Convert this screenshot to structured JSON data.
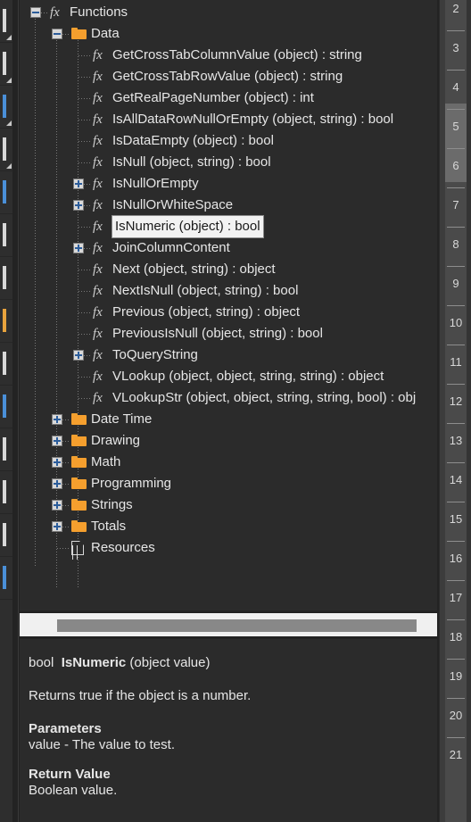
{
  "left_strip": {
    "name": "adjacent-panel-sliver",
    "items": [
      {
        "mark": "white"
      },
      {
        "mark": "white"
      },
      {
        "mark": "blue"
      },
      {
        "mark": "white"
      },
      {
        "mark": "blue"
      },
      {
        "mark": "white"
      },
      {
        "mark": "white"
      },
      {
        "mark": "orange"
      },
      {
        "mark": "white"
      },
      {
        "mark": "blue"
      },
      {
        "mark": "white"
      },
      {
        "mark": "white"
      },
      {
        "mark": "white"
      },
      {
        "mark": "blue"
      }
    ]
  },
  "tree": {
    "name": "functions-tree",
    "nodes": [
      {
        "label": "Functions",
        "depth": 0,
        "icon": "fx-icon",
        "toggle": "minus",
        "selected": false
      },
      {
        "label": "Data",
        "depth": 1,
        "icon": "folder-icon",
        "toggle": "minus",
        "selected": false
      },
      {
        "label": "GetCrossTabColumnValue (object) : string",
        "depth": 2,
        "icon": "fx-icon",
        "toggle": "none",
        "selected": false
      },
      {
        "label": "GetCrossTabRowValue (object) : string",
        "depth": 2,
        "icon": "fx-icon",
        "toggle": "none",
        "selected": false
      },
      {
        "label": "GetRealPageNumber (object) : int",
        "depth": 2,
        "icon": "fx-icon",
        "toggle": "none",
        "selected": false
      },
      {
        "label": "IsAllDataRowNullOrEmpty (object, string) : bool",
        "depth": 2,
        "icon": "fx-icon",
        "toggle": "none",
        "selected": false
      },
      {
        "label": "IsDataEmpty (object) : bool",
        "depth": 2,
        "icon": "fx-icon",
        "toggle": "none",
        "selected": false
      },
      {
        "label": "IsNull (object, string) : bool",
        "depth": 2,
        "icon": "fx-icon",
        "toggle": "none",
        "selected": false
      },
      {
        "label": "IsNullOrEmpty",
        "depth": 2,
        "icon": "fx-icon",
        "toggle": "plus",
        "selected": false
      },
      {
        "label": "IsNullOrWhiteSpace",
        "depth": 2,
        "icon": "fx-icon",
        "toggle": "plus",
        "selected": false
      },
      {
        "label": "IsNumeric (object) : bool",
        "depth": 2,
        "icon": "fx-icon",
        "toggle": "none",
        "selected": true
      },
      {
        "label": "JoinColumnContent",
        "depth": 2,
        "icon": "fx-icon",
        "toggle": "plus",
        "selected": false
      },
      {
        "label": "Next (object, string) : object",
        "depth": 2,
        "icon": "fx-icon",
        "toggle": "none",
        "selected": false
      },
      {
        "label": "NextIsNull (object, string) : bool",
        "depth": 2,
        "icon": "fx-icon",
        "toggle": "none",
        "selected": false
      },
      {
        "label": "Previous (object, string) : object",
        "depth": 2,
        "icon": "fx-icon",
        "toggle": "none",
        "selected": false
      },
      {
        "label": "PreviousIsNull (object, string) : bool",
        "depth": 2,
        "icon": "fx-icon",
        "toggle": "none",
        "selected": false
      },
      {
        "label": "ToQueryString",
        "depth": 2,
        "icon": "fx-icon",
        "toggle": "plus",
        "selected": false
      },
      {
        "label": "VLookup (object, object, string, string) : object",
        "depth": 2,
        "icon": "fx-icon",
        "toggle": "none",
        "selected": false
      },
      {
        "label": "VLookupStr (object, object, string, string, bool) : obj",
        "depth": 2,
        "icon": "fx-icon",
        "toggle": "none",
        "selected": false
      },
      {
        "label": "Date Time",
        "depth": 1,
        "icon": "folder-icon",
        "toggle": "plus",
        "selected": false
      },
      {
        "label": "Drawing",
        "depth": 1,
        "icon": "folder-icon",
        "toggle": "plus",
        "selected": false
      },
      {
        "label": "Math",
        "depth": 1,
        "icon": "folder-icon",
        "toggle": "plus",
        "selected": false
      },
      {
        "label": "Programming",
        "depth": 1,
        "icon": "folder-icon",
        "toggle": "plus",
        "selected": false
      },
      {
        "label": "Strings",
        "depth": 1,
        "icon": "folder-icon",
        "toggle": "plus",
        "selected": false
      },
      {
        "label": "Totals",
        "depth": 1,
        "icon": "folder-icon",
        "toggle": "plus",
        "selected": false
      },
      {
        "label": "Resources",
        "depth": 1,
        "icon": "document-icon",
        "toggle": "none",
        "selected": false
      }
    ]
  },
  "hscroll": {
    "name": "horizontal-scrollbar",
    "thumb_left_pct": 9,
    "thumb_width_pct": 86
  },
  "description": {
    "name": "function-description",
    "return_type": "bool",
    "function_name": "IsNumeric",
    "signature_args": "(object value)",
    "summary": "Returns true if the object is a number.",
    "parameters_heading": "Parameters",
    "parameters_body": "value - The value to test.",
    "return_heading": "Return Value",
    "return_body": "Boolean value."
  },
  "ruler": {
    "name": "vertical-scrollbar-ruler",
    "numbers": [
      "2",
      "3",
      "4",
      "5",
      "6",
      "7",
      "8",
      "9",
      "10",
      "11",
      "12",
      "13",
      "14",
      "15",
      "16",
      "17",
      "18",
      "19",
      "20",
      "21"
    ],
    "thumb_start_number": "5",
    "thumb_end_number": "6"
  },
  "colors": {
    "panel_bg": "#2b2b2b",
    "window_bg": "#232323",
    "text": "#e6e6e6",
    "folder": "#f59f2e",
    "selection_bg": "#f2f2f2",
    "selection_text": "#1a1a1a",
    "scrollbar_track": "#f0f0f0",
    "scrollbar_thumb": "#888888",
    "toggle_glyph": "#2c5d9b"
  }
}
